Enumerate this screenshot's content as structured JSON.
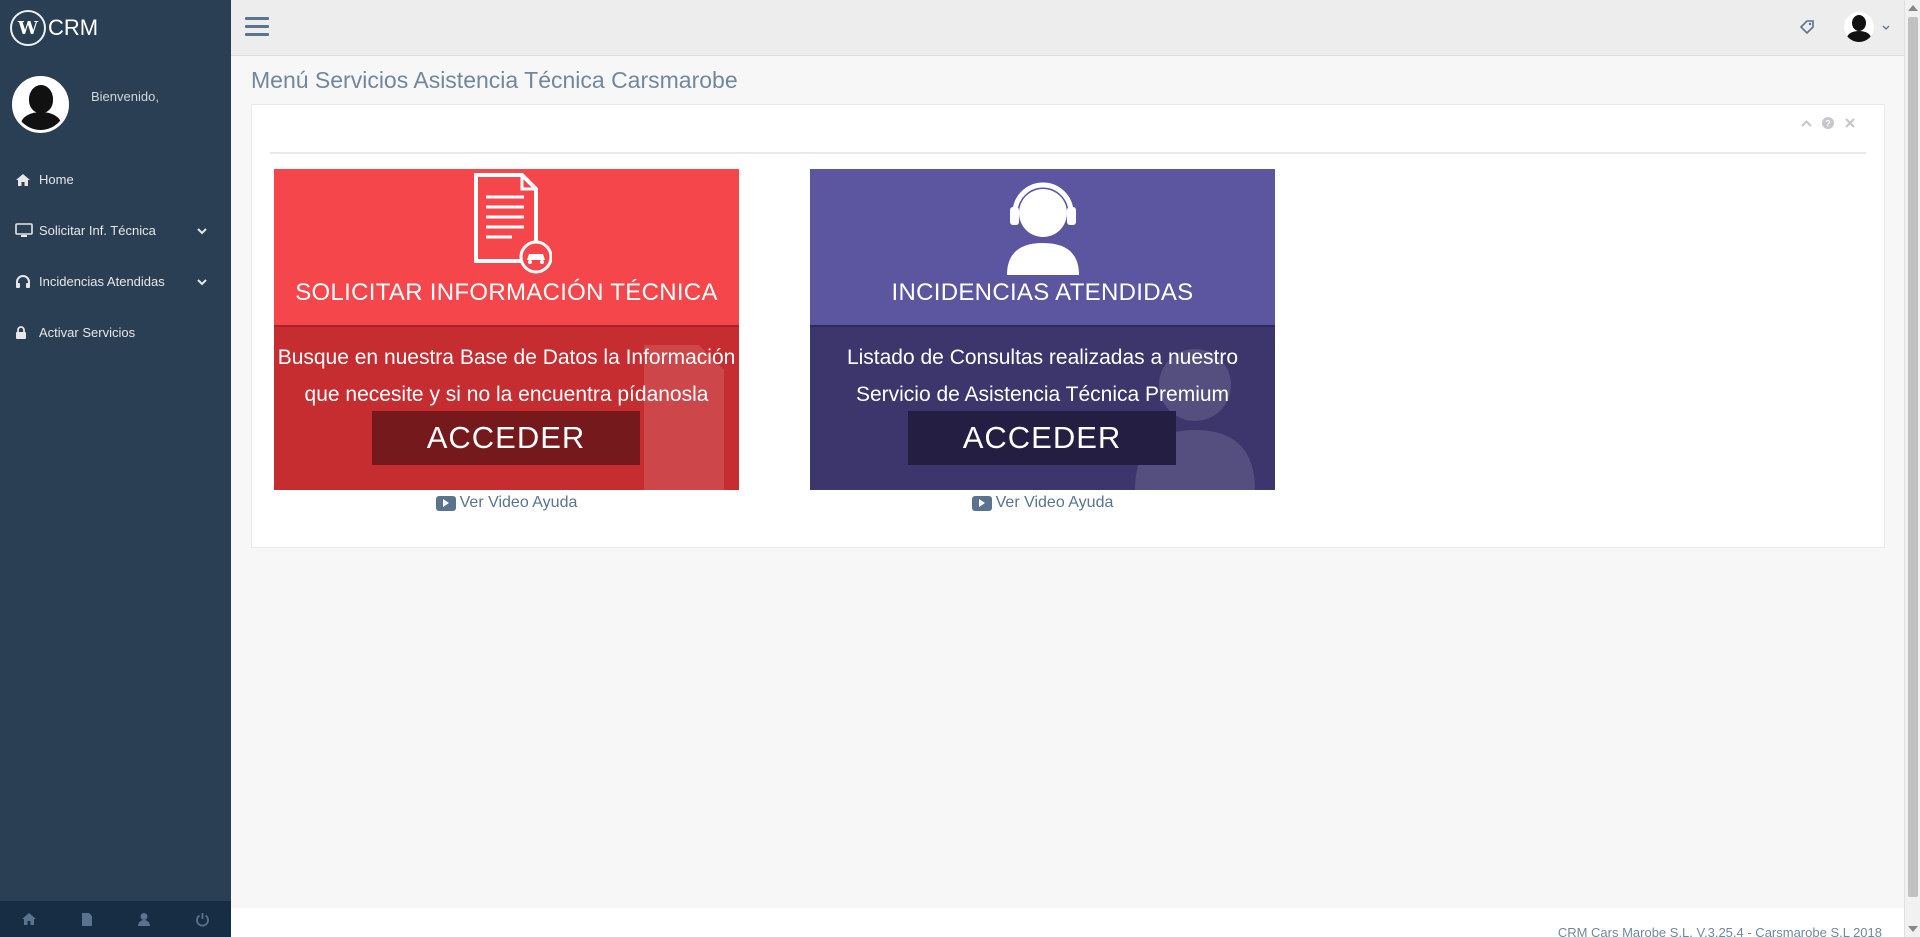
{
  "brand": {
    "logo_letter": "W",
    "name": "CRM"
  },
  "profile": {
    "welcome": "Bienvenido,"
  },
  "sidebar": {
    "items": [
      {
        "label": "Home",
        "icon": "home-icon",
        "has_submenu": false
      },
      {
        "label": "Solicitar Inf. Técnica",
        "icon": "desktop-icon",
        "has_submenu": true
      },
      {
        "label": "Incidencias Atendidas",
        "icon": "headphones-icon",
        "has_submenu": true
      },
      {
        "label": "Activar Servicios",
        "icon": "lock-icon",
        "has_submenu": false
      }
    ],
    "footer_icons": [
      "home-icon",
      "file-icon",
      "user-icon",
      "power-icon"
    ]
  },
  "page": {
    "title": "Menú Servicios Asistencia Técnica Carsmarobe"
  },
  "cards": [
    {
      "title": "SOLICITAR INFORMACIÓN TÉCNICA",
      "desc_line1": "Busque en nuestra Base de Datos la Información",
      "desc_line2": "que necesite y si no la encuentra pídanosla",
      "button": "ACCEDER",
      "video_link": "Ver Video Ayuda",
      "top_color": "#f5474b",
      "bottom_color": "#c62d31"
    },
    {
      "title": "INCIDENCIAS ATENDIDAS",
      "desc_line1": "Listado de Consultas realizadas a nuestro",
      "desc_line2": "Servicio de Asistencia Técnica Premium",
      "button": "ACCEDER",
      "video_link": "Ver Video Ayuda",
      "top_color": "#5c56a1",
      "bottom_color": "#3c366d"
    }
  ],
  "footer": {
    "text": "CRM Cars Marobe S.L. V.3.25.4 - Carsmarobe S.L 2018"
  },
  "colors": {
    "sidebar": "#2a3f54",
    "accent_text": "#73879c"
  }
}
